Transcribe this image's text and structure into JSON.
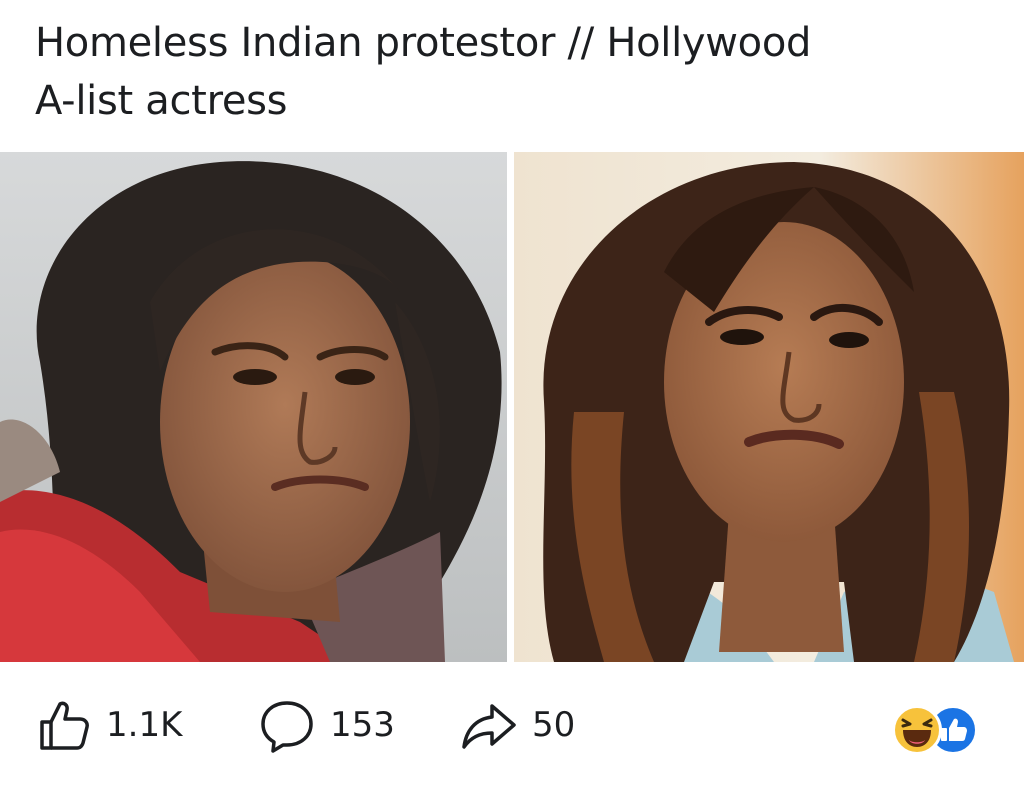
{
  "post": {
    "caption_line1": "Homeless Indian protestor // Hollywood",
    "caption_line2": "A-list actress"
  },
  "images": {
    "left": {
      "desc": "photo-left"
    },
    "right": {
      "desc": "photo-right"
    }
  },
  "actions": {
    "like_count": "1.1K",
    "comment_count": "153",
    "share_count": "50"
  },
  "reactions": {
    "types": [
      "haha-icon",
      "like-icon"
    ],
    "colors": {
      "haha": "#f7c23b",
      "like": "#1b74e4"
    }
  }
}
